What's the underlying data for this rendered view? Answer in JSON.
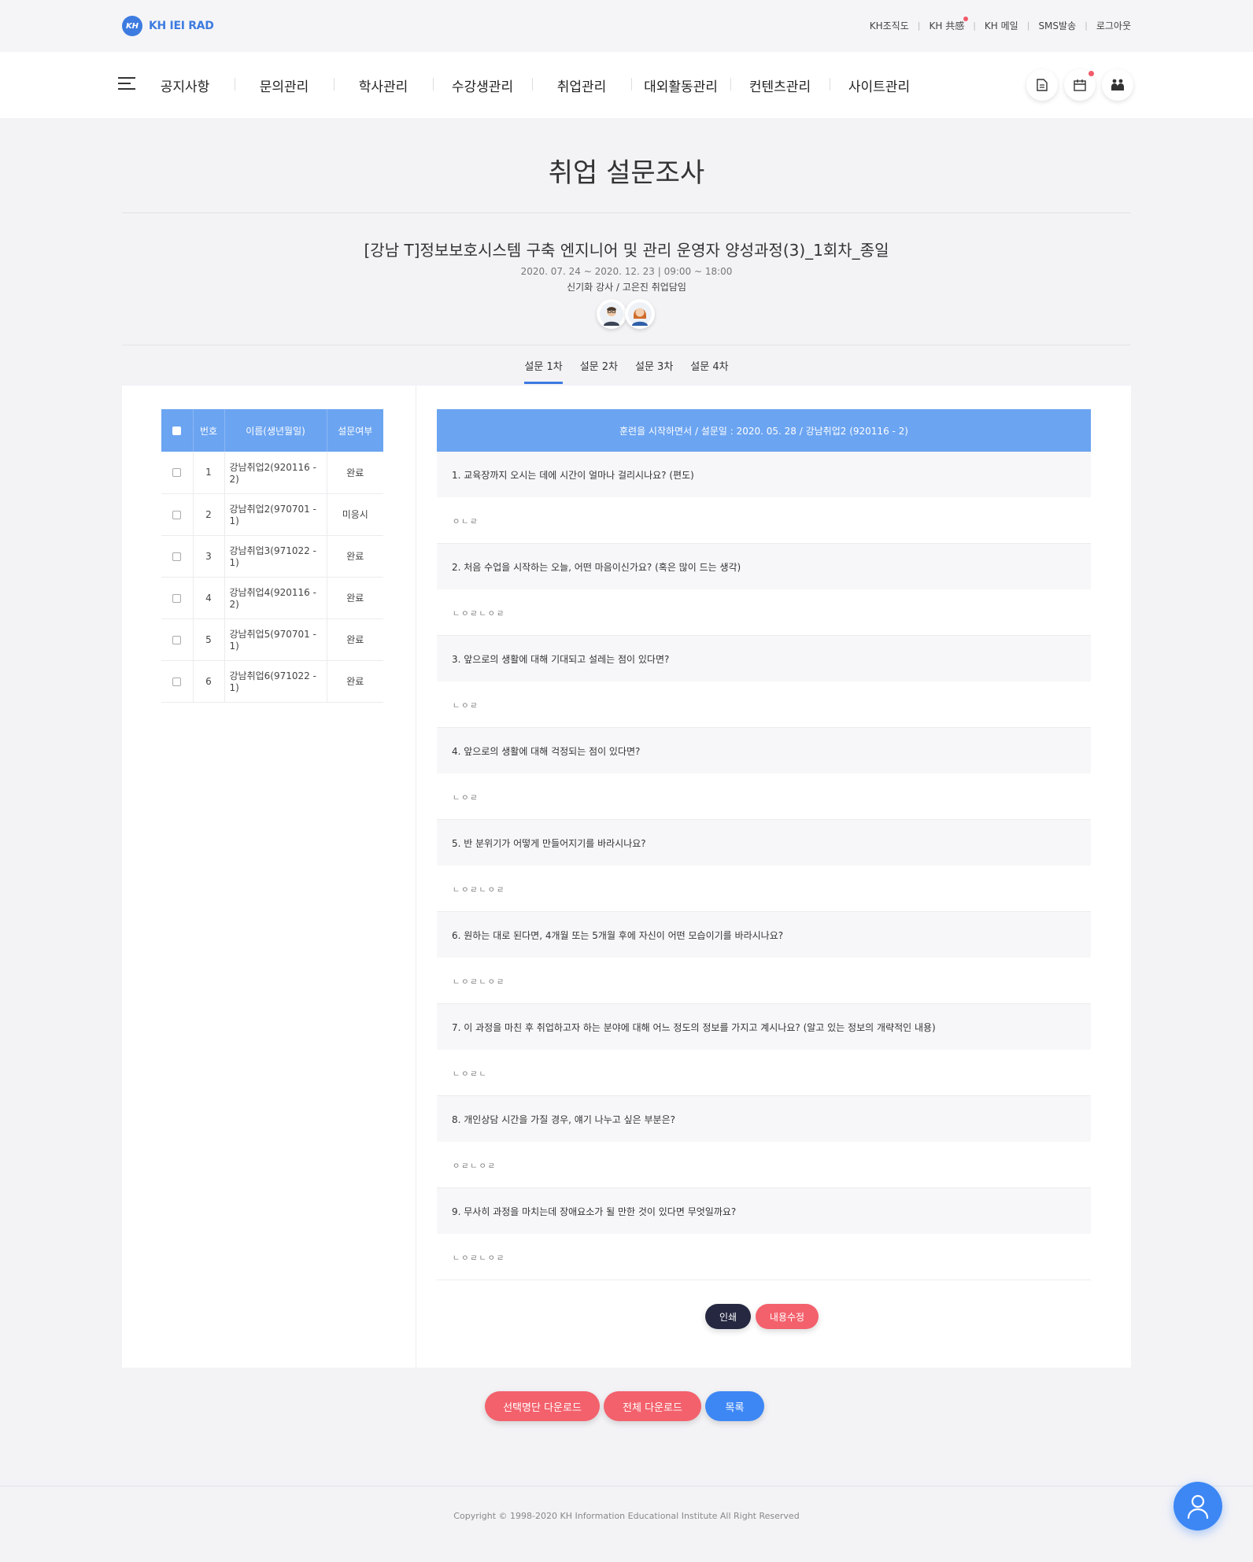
{
  "header": {
    "logo_text": "KH IEI RAD",
    "logo_mark": "KH",
    "util_links": [
      "KH조직도",
      "KH 共感",
      "KH 메일",
      "SMS발송",
      "로그아웃"
    ],
    "util_sep": "|"
  },
  "gnb": {
    "menu": [
      "공지사항",
      "문의관리",
      "학사관리",
      "수강생관리",
      "취업관리",
      "대외활동관리",
      "컨텐츠관리",
      "사이트관리"
    ],
    "icons": [
      "document-icon",
      "calendar-icon",
      "people-icon"
    ]
  },
  "page": {
    "title": "취업 설문조사",
    "course_title": "[강남 T]정보보호시스템 구축 엔지니어 및 관리 운영자 양성과정(3)_1회차_종일",
    "course_date": "2020. 07. 24 ~ 2020. 12. 23 | 09:00 ~ 18:00",
    "course_staff": "신기화 강사 / 고은진 취업담임"
  },
  "tabs": [
    "설문 1차",
    "설문 2차",
    "설문 3차",
    "설문 4차"
  ],
  "student_table": {
    "headers": [
      "번호",
      "이름(생년월일)",
      "설문여부"
    ],
    "rows": [
      {
        "no": "1",
        "name": "강남취업2(920116 - 2)",
        "status": "완료"
      },
      {
        "no": "2",
        "name": "강남취업2(970701 - 1)",
        "status": "미응시"
      },
      {
        "no": "3",
        "name": "강남취업3(971022 - 1)",
        "status": "완료"
      },
      {
        "no": "4",
        "name": "강남취업4(920116 - 2)",
        "status": "완료"
      },
      {
        "no": "5",
        "name": "강남취업5(970701 - 1)",
        "status": "완료"
      },
      {
        "no": "6",
        "name": "강남취업6(971022 - 1)",
        "status": "완료"
      }
    ]
  },
  "survey": {
    "header": "훈련을 시작하면서 /  설문일 : 2020. 05. 28 /  강남취업2 (920116 - 2)",
    "items": [
      {
        "q": "1. 교육장까지 오시는 데에 시간이 얼마나 걸리시나요? (편도)",
        "a": "ㅇㄴㄹ"
      },
      {
        "q": "2. 처음 수업을 시작하는 오늘, 어떤 마음이신가요? (혹은 많이 드는 생각)",
        "a": "ㄴㅇㄹㄴㅇㄹ"
      },
      {
        "q": "3. 앞으로의 생활에 대해 기대되고 설레는 점이 있다면?",
        "a": "ㄴㅇㄹ"
      },
      {
        "q": "4. 앞으로의 생활에 대해 걱정되는 점이 있다면?",
        "a": "ㄴㅇㄹ"
      },
      {
        "q": "5. 반 분위기가 어떻게 만들어지기를 바라시나요?",
        "a": "ㄴㅇㄹㄴㅇㄹ"
      },
      {
        "q": "6. 원하는 대로 된다면, 4개월 또는 5개월 후에 자신이 어떤 모습이기를 바라시나요?",
        "a": "ㄴㅇㄹㄴㅇㄹ"
      },
      {
        "q": "7. 이 과정을 마친 후 취업하고자 하는 분야에 대해 어느 정도의 정보를 가지고 계시나요? (알고 있는 정보의 개략적인 내용)",
        "a": "ㄴㅇㄹㄴ"
      },
      {
        "q": "8. 개인상담 시간을 가질 경우, 얘기 나누고 싶은 부분은?",
        "a": "ㅇㄹㄴㅇㄹ"
      },
      {
        "q": "9. 무사히 과정을 마치는데 장애요소가 될 만한 것이 있다면 무엇일까요?",
        "a": "ㄴㅇㄹㄴㅇㄹ"
      }
    ],
    "print_label": "인쇄",
    "edit_label": "내용수정"
  },
  "bottom_buttons": {
    "download_selected": "선택명단 다운로드",
    "download_all": "전체 다운로드",
    "list": "목록"
  },
  "footer": {
    "copyright": "Copyright © 1998-2020 KH Information Educational Institute All Right Reserved"
  },
  "colors": {
    "primary": "#3d7be0",
    "table_header": "#6ba4f1",
    "coral": "#f3616c",
    "navy": "#252840",
    "blue": "#3d87f5"
  }
}
